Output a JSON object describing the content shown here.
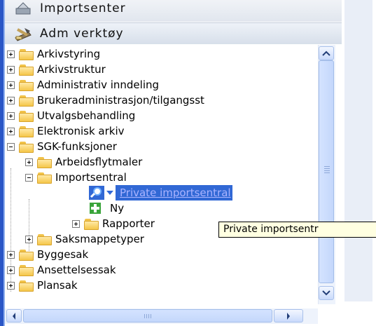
{
  "panel": {
    "headers": [
      {
        "label": "Importsenter",
        "icon": "import-center-icon"
      },
      {
        "label": "Adm verktøy",
        "icon": "admin-tools-icon"
      }
    ]
  },
  "tree": {
    "items": [
      {
        "label": "Arkivstyring",
        "expander": "plus",
        "level": 0
      },
      {
        "label": "Arkivstruktur",
        "expander": "plus",
        "level": 0
      },
      {
        "label": "Administrativ inndeling",
        "expander": "plus",
        "level": 0
      },
      {
        "label": "Brukeradministrasjon/tilgangsst",
        "expander": "plus",
        "level": 0
      },
      {
        "label": "Utvalgsbehandling",
        "expander": "plus",
        "level": 0
      },
      {
        "label": "Elektronisk arkiv",
        "expander": "plus",
        "level": 0
      },
      {
        "label": "SGK-funksjoner",
        "expander": "minus",
        "level": 0
      },
      {
        "label": "Arbeidsflytmaler",
        "expander": "plus",
        "level": 1
      },
      {
        "label": "Importsentral",
        "expander": "minus",
        "level": 1
      },
      {
        "label": "Private importsentral",
        "level": 2,
        "selected": true,
        "icon": "search-icon"
      },
      {
        "label": "Ny",
        "level": 2,
        "icon": "add-icon"
      },
      {
        "label": "Rapporter",
        "expander": "plus",
        "level": 2
      },
      {
        "label": "Saksmappetyper",
        "expander": "plus",
        "level": 1
      },
      {
        "label": "Byggesak",
        "expander": "plus",
        "level": 0
      },
      {
        "label": "Ansettelsessak",
        "expander": "plus",
        "level": 0
      },
      {
        "label": "Plansak",
        "expander": "plus",
        "level": 0
      }
    ]
  },
  "tooltip": {
    "text": "Private importsentr"
  },
  "colors": {
    "selection": "#3168d5",
    "frame": "#2a56c6",
    "folder": "#f5c649"
  }
}
